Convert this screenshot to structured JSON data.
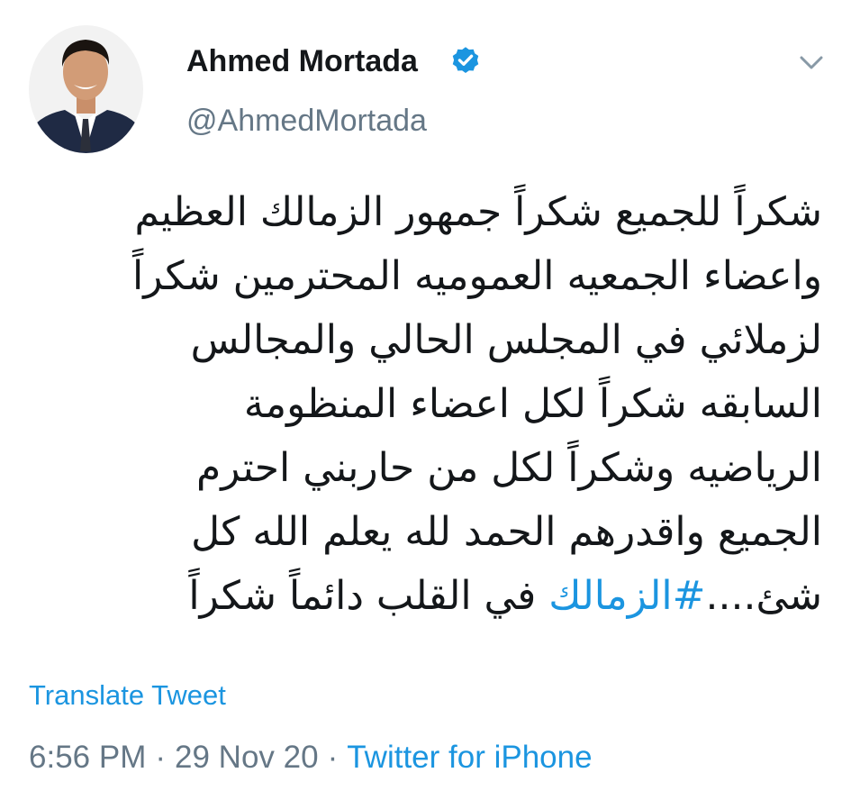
{
  "author": {
    "display_name": "Ahmed Mortada",
    "handle": "@AhmedMortada",
    "verified": true,
    "avatar_icon": "profile-photo"
  },
  "tweet": {
    "lines": [
      "شكراً للجميع شكراً جمهور الزمالك العظيم",
      "واعضاء الجمعيه العموميه المحترمين شكراً",
      "لزملائي في المجلس الحالي والمجالس",
      "السابقه شكراً لكل اعضاء المنظومة",
      "الرياضيه وشكراً لكل من حاربني احترم",
      "الجميع واقدرهم الحمد لله يعلم الله كل"
    ],
    "last_line": {
      "prefix": "شئ....",
      "hashtag": "#الزمالك",
      "suffix": " في القلب دائماً شكراً"
    },
    "translate_label": "Translate Tweet",
    "time": "6:56 PM",
    "separator": "·",
    "date": "29 Nov 20",
    "source": "Twitter for iPhone"
  },
  "colors": {
    "accent": "#1b95e0",
    "secondary_text": "#657786",
    "primary_text": "#14171a"
  },
  "icons": {
    "verified": "verified-badge-icon",
    "menu": "chevron-down-icon"
  }
}
